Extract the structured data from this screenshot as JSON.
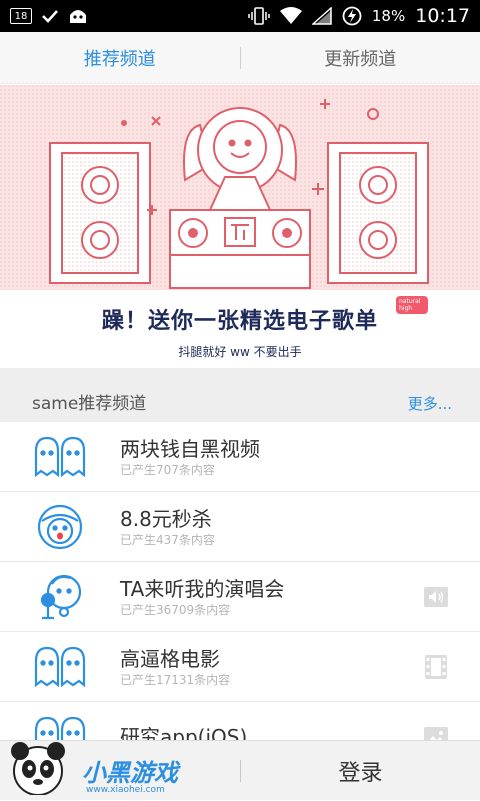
{
  "status_bar": {
    "notification_count": "18",
    "battery": "18%",
    "time": "10:17"
  },
  "tabs": [
    {
      "label": "推荐频道",
      "active": true
    },
    {
      "label": "更新频道",
      "active": false
    }
  ],
  "banner": {
    "title": "躁！送你一张精选电子歌单",
    "subtitle": "抖腿就好 ww 不要出手",
    "tag_line1": "natural",
    "tag_line2": "high"
  },
  "section": {
    "title": "same推荐频道",
    "more": "更多..."
  },
  "channels": [
    {
      "name": "两块钱自黑视频",
      "count": "已产生707条内容",
      "icon": "ghost-pair-icon",
      "badge": ""
    },
    {
      "name": "8.8元秒杀",
      "count": "已产生437条内容",
      "icon": "helmet-face-icon",
      "badge": ""
    },
    {
      "name": "TA来听我的演唱会",
      "count": "已产生36709条内容",
      "icon": "singer-icon",
      "badge": "audio-icon"
    },
    {
      "name": "高逼格电影",
      "count": "已产生17131条内容",
      "icon": "ghost-pair-icon",
      "badge": "film-icon"
    },
    {
      "name": "研究app(iOS)",
      "count": "",
      "icon": "ghost-pair-icon",
      "badge": "image-icon"
    }
  ],
  "bottom": {
    "login": "登录",
    "watermark": "小黑游戏",
    "watermark_url": "www.xiaohei.com"
  },
  "colors": {
    "accent": "#2d8fe0",
    "banner_bg": "#fbe3e4",
    "banner_line": "#e0606a",
    "banner_text": "#1e2a5a"
  }
}
